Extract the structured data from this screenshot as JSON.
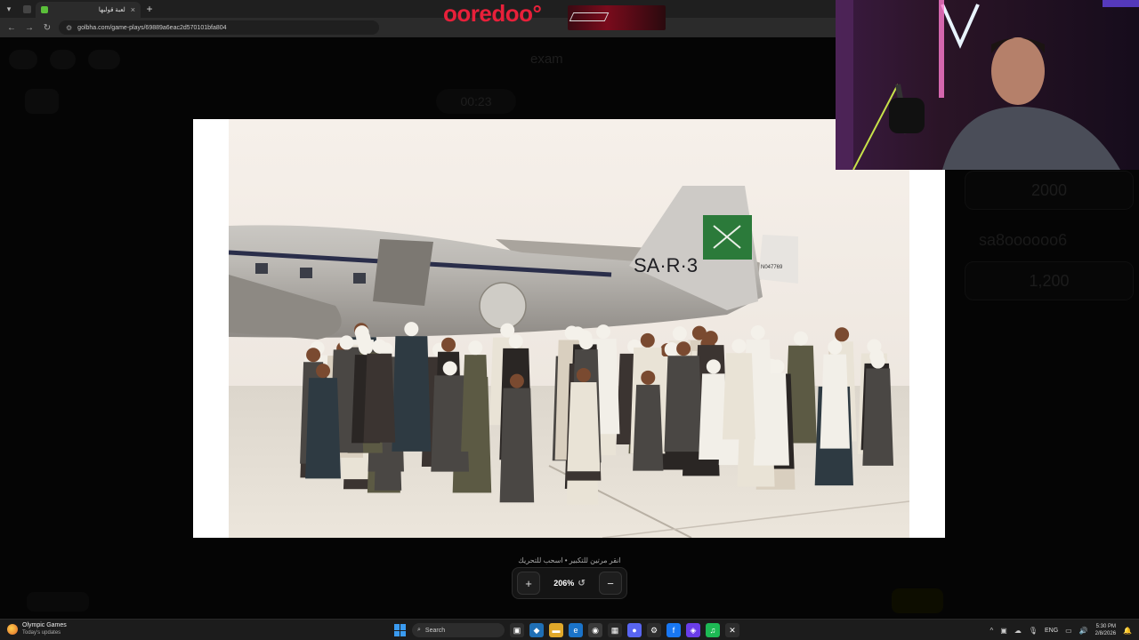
{
  "browser": {
    "tab_title": "لعبة قولبها",
    "url": "golbha.com/game-plays/69889a6eac2d570101bfa804",
    "new_tab": "+",
    "tab_close": "×",
    "nav_back": "←",
    "nav_forward": "→",
    "reload": "↻"
  },
  "banner": {
    "logo_text": "ooredoo°"
  },
  "background_page": {
    "title": "exam",
    "timer": "00:23",
    "team_score": "2000",
    "team_name": "sa8oooooo6",
    "team_score_2": "1,200"
  },
  "viewer": {
    "hint": "انقر مرتين للتكبير • اسحب للتحريك",
    "zoom_level": "206%",
    "zoom_in": "+",
    "zoom_out": "−",
    "reset_icon": "↺",
    "photo": {
      "tail_registration": "SA·R·3",
      "other_registration": "N047769"
    }
  },
  "taskbar": {
    "widget_title": "Olympic Games",
    "widget_subtitle": "Today's updates",
    "search_label": "Search",
    "lang": "ENG",
    "time": "5:30 PM",
    "date": "2/8/2026"
  },
  "colors": {
    "brand_red": "#e8203a",
    "taskbar_bg": "#1c1c1c",
    "windows_blue": "#3a9bf0"
  }
}
